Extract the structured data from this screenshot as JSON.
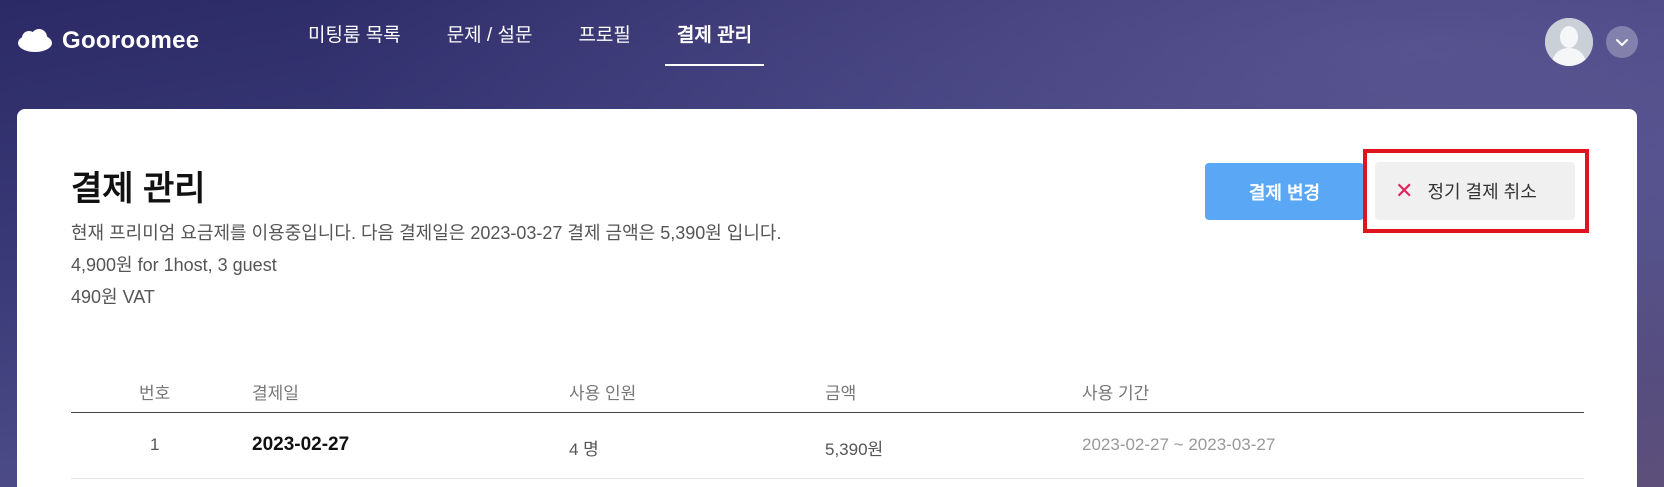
{
  "header": {
    "logo_text": "Gooroomee",
    "nav": [
      {
        "label": "미팅룸 목록"
      },
      {
        "label": "문제 / 설문"
      },
      {
        "label": "프로필"
      },
      {
        "label": "결제 관리"
      }
    ]
  },
  "page": {
    "title": "결제 관리",
    "info_lines": [
      "현재 프리미엄 요금제를 이용중입니다. 다음 결제일은 2023-03-27 결제 금액은 5,390원 입니다.",
      "4,900원 for 1host, 3 guest",
      "490원 VAT"
    ],
    "change_button": "결제 변경",
    "cancel_button": "정기 결제 취소"
  },
  "table": {
    "headers": [
      "번호",
      "결제일",
      "사용 인원",
      "금액",
      "사용 기간"
    ],
    "rows": [
      {
        "no": "1",
        "date": "2023-02-27",
        "users": "4 명",
        "amount": "5,390원",
        "period": "2023-02-27 ~ 2023-03-27"
      }
    ]
  },
  "colors": {
    "primary_button": "#5aa7f6",
    "highlight_frame": "#e0141f",
    "cancel_icon": "#e0245e"
  }
}
